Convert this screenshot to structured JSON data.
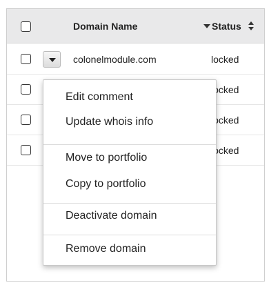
{
  "table": {
    "header": {
      "domain_label": "Domain Name",
      "status_label": "Status"
    },
    "rows": [
      {
        "domain": "colonelmodule.com",
        "status": "locked"
      },
      {
        "domain": "",
        "status": "locked"
      },
      {
        "domain": "",
        "status": "locked"
      },
      {
        "domain": "",
        "status": "locked"
      }
    ]
  },
  "menu": {
    "items": [
      {
        "label": "Edit comment"
      },
      {
        "label": "Update whois info"
      },
      {
        "label": "Move to portfolio"
      },
      {
        "label": "Copy to portfolio"
      },
      {
        "label": "Deactivate domain"
      },
      {
        "label": "Remove domain"
      }
    ]
  }
}
